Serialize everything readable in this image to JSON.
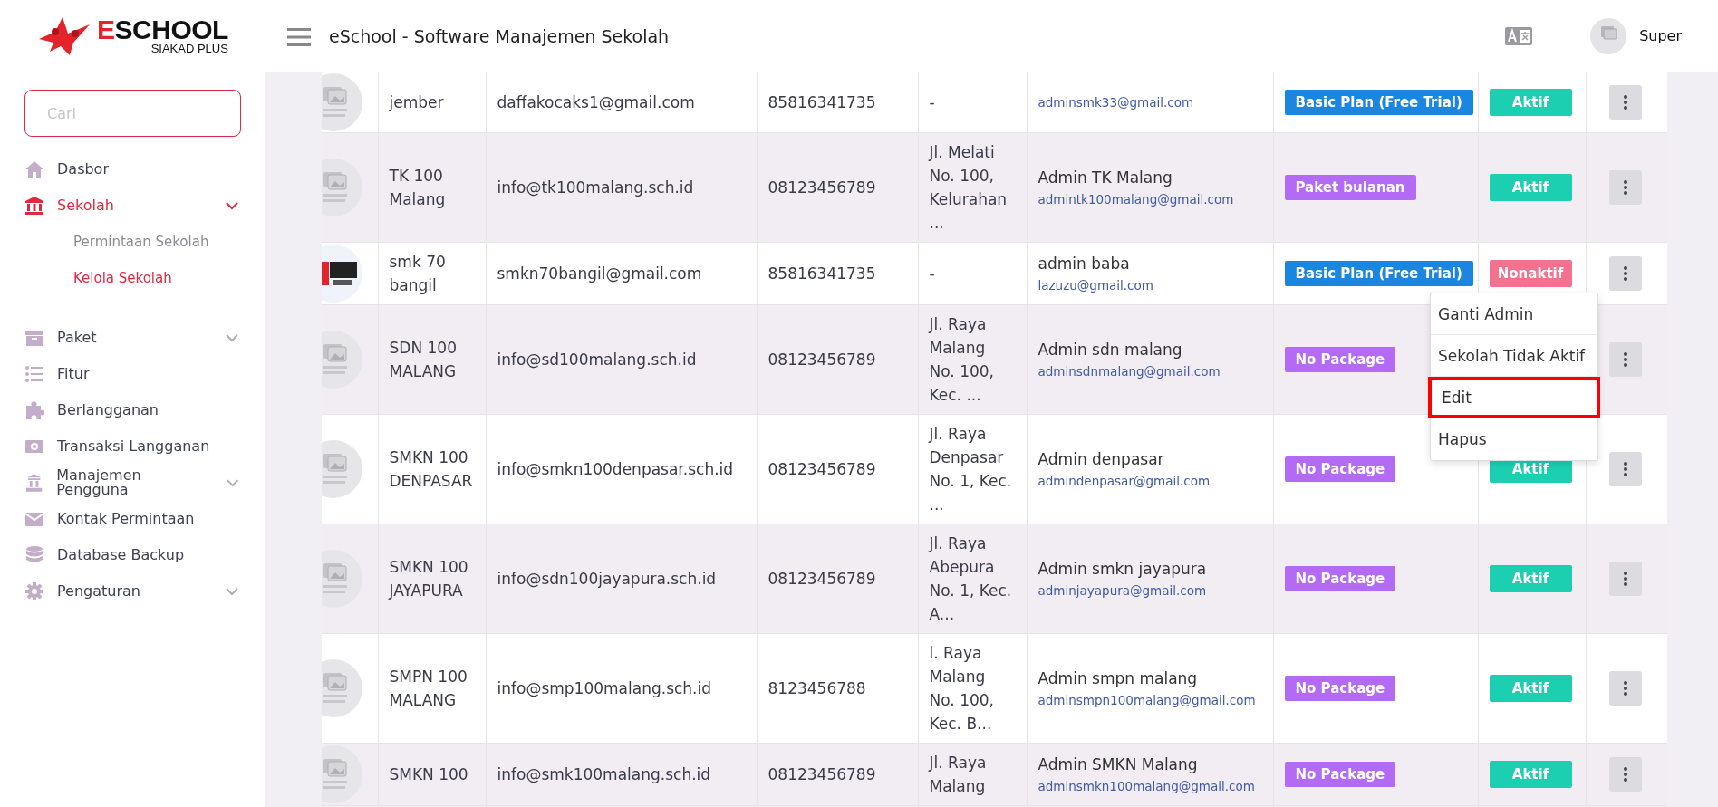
{
  "brand": {
    "name": "ESCHOOL",
    "tagline": "SIAKAD PLUS"
  },
  "header": {
    "title": "eSchool - Software Manajemen Sekolah",
    "user": "Super"
  },
  "sidebar": {
    "search": {
      "placeholder": "Cari"
    },
    "items": [
      {
        "label": "Dasbor",
        "selected": false
      },
      {
        "label": "Sekolah",
        "selected": true,
        "expanded": true,
        "children": [
          {
            "label": "Permintaan Sekolah",
            "selected": false
          },
          {
            "label": "Kelola Sekolah",
            "selected": true
          }
        ]
      },
      {
        "label": "Paket",
        "selected": false,
        "expanded": false
      },
      {
        "label": "Fitur",
        "selected": false
      },
      {
        "label": "Berlangganan",
        "selected": false
      },
      {
        "label": "Transaksi Langganan",
        "selected": false
      },
      {
        "label": "Manajemen Pengguna",
        "selected": false,
        "expanded": false
      },
      {
        "label": "Kontak Permintaan",
        "selected": false
      },
      {
        "label": "Database Backup",
        "selected": false
      },
      {
        "label": "Pengaturan",
        "selected": false,
        "expanded": false
      }
    ]
  },
  "table": {
    "rows": [
      {
        "name": "jember",
        "email": "daffakocaks1@gmail.com",
        "phone": "85816341735",
        "address": "-",
        "admin_email": "adminsmk33@gmail.com",
        "package": "Basic Plan (Free Trial)",
        "color": "#1a86e0",
        "status": "Aktif",
        "active": true
      },
      {
        "name": "TK 100 Malang",
        "email": "info@tk100malang.sch.id",
        "phone": "08123456789",
        "address": "Jl. Melati No. 100, Kelurahan ...",
        "admin_name": "Admin TK Malang",
        "admin_email": "admintk100malang@gmail.com",
        "package": "Paket bulanan",
        "color": "#b36af5",
        "status": "Aktif",
        "active": true
      },
      {
        "name": "smk 70 bangil",
        "email": "smkn70bangil@gmail.com",
        "phone": "85816341735",
        "address": "-",
        "admin_name": "admin baba",
        "admin_email": "lazuzu@gmail.com",
        "package": "Basic Plan (Free Trial)",
        "color": "#1a86e0",
        "status": "Nonaktif",
        "active": false,
        "menu": [
          {
            "label": "Ganti Admin",
            "highlighted": false
          },
          {
            "label": "Sekolah Tidak Aktif",
            "highlighted": false
          },
          {
            "label": "Edit",
            "highlighted": true
          },
          {
            "label": "Hapus",
            "highlighted": false
          }
        ]
      },
      {
        "name": "SDN 100 MALANG",
        "email": "info@sd100malang.sch.id",
        "phone": "08123456789",
        "address": "Jl. Raya Malang No. 100, Kec. ...",
        "admin_name": "Admin sdn malang",
        "admin_email": "adminsdnmalang@gmail.com",
        "package": "No Package",
        "color": "#b36af5"
      },
      {
        "name": "SMKN 100 DENPASAR",
        "email": "info@smkn100denpasar.sch.id",
        "phone": "08123456789",
        "address": "Jl. Raya Denpasar No. 1, Kec. ...",
        "admin_name": "Admin denpasar",
        "admin_email": "admindenpasar@gmail.com",
        "package": "No Package",
        "color": "#b36af5",
        "status": "Aktif",
        "active": true
      },
      {
        "name": "SMKN 100 JAYAPURA",
        "email": "info@sdn100jayapura.sch.id",
        "phone": "08123456789",
        "address": "Jl. Raya Abepura No. 1, Kec. A...",
        "admin_name": "Admin smkn jayapura",
        "admin_email": "adminjayapura@gmail.com",
        "package": "No Package",
        "color": "#b36af5",
        "status": "Aktif",
        "active": true
      },
      {
        "name": "SMPN 100 MALANG",
        "email": "info@smp100malang.sch.id",
        "phone": "8123456788",
        "address": "l. Raya Malang No. 100, Kec. B...",
        "admin_name": "Admin smpn malang",
        "admin_email": "adminsmpn100malang@gmail.com",
        "package": "No Package",
        "color": "#b36af5",
        "status": "Aktif",
        "active": true
      },
      {
        "name": "SMKN 100",
        "email": "info@smk100malang.sch.id",
        "phone": "08123456789",
        "address": "Jl. Raya Malang",
        "admin_name": "Admin SMKN Malang",
        "admin_email": "adminsmkn100malang@gmail.com",
        "package": "No Package",
        "color": "#b36af5",
        "status": "Aktif",
        "active": true
      }
    ]
  }
}
